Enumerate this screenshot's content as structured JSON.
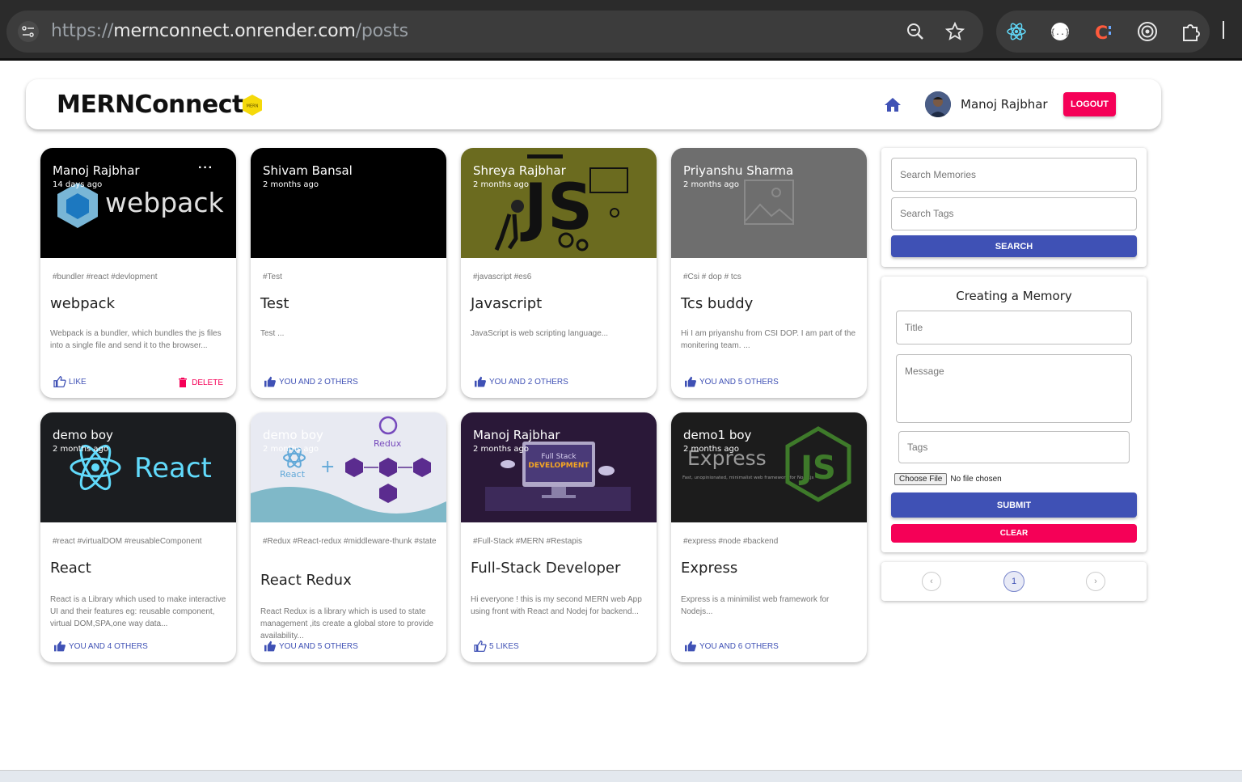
{
  "browser": {
    "url_scheme": "https://",
    "url_host": "mernconnect.onrender.com",
    "url_path": "/posts",
    "icons": [
      "site-settings-icon",
      "zoom-icon",
      "bookmark-star-icon",
      "react-devtools-icon",
      "json-viewer-icon",
      "color-picker-icon",
      "target-icon",
      "extensions-puzzle-icon"
    ]
  },
  "header": {
    "brand": "MERNConnect",
    "logo_text": "MERN",
    "user_name": "Manoj Rajbhar",
    "logout_label": "LOGOUT"
  },
  "posts": [
    {
      "author": "Manoj Rajbhar",
      "time": "14 days ago",
      "tags": "#bundler #react #devlopment",
      "title": "webpack",
      "message": "Webpack is a bundler, which bundles the js files into a single file and send it to the browser...",
      "likes": "LIKE",
      "delete_label": "DELETE",
      "media_bg": "#000000",
      "media_text": "webpack"
    },
    {
      "author": "Shivam Bansal",
      "time": "2 months ago",
      "tags": "#Test",
      "title": "Test",
      "message": "Test ...",
      "likes": "YOU AND 2 OTHERS",
      "media_bg": "#000000"
    },
    {
      "author": "Shreya Rajbhar",
      "time": "2 months ago",
      "tags": "#javascript #es6",
      "title": "Javascript",
      "message": "JavaScript is web scripting language...",
      "likes": "YOU AND 2 OTHERS",
      "media_bg": "#6b6b1f",
      "media_text": "JS"
    },
    {
      "author": "Priyanshu Sharma",
      "time": "2 months ago",
      "tags": "#Csi # dop # tcs",
      "title": "Tcs buddy",
      "message": "Hi I am priyanshu from CSI DOP. I am part of the monitering team. ...",
      "likes": "YOU AND 5 OTHERS",
      "media_bg": "#6e6e6e"
    },
    {
      "author": "demo boy",
      "time": "2 months ago",
      "tags": "#react #virtualDOM #reusableComponent",
      "title": "React",
      "message": "React is a Library which used to make interactive UI and their features eg: reusable component, virtual DOM,SPA,one way data...",
      "likes": "YOU AND 4 OTHERS",
      "media_bg": "#1b1d20",
      "media_text": "React"
    },
    {
      "author": "demo boy",
      "time": "2 months ago",
      "tags": "#Redux #React-redux #middleware-thunk #state",
      "title": "React Redux",
      "message": "React Redux is a library which is used to state management ,its create a global store to provide availability...",
      "likes": "YOU AND 5 OTHERS",
      "media_bg": "#e8eaf2",
      "media_text": "Redux",
      "media_text_2": "React"
    },
    {
      "author": "Manoj Rajbhar",
      "time": "2 months ago",
      "tags": "#Full-Stack #MERN #Restapis",
      "title": "Full-Stack Developer",
      "message": "Hi everyone ! this is my second MERN web App using front with React and Nodej for backend...",
      "likes": "5 LIKES",
      "media_bg": "#2a1838",
      "media_text": "Full Stack",
      "media_text_2": "DEVELOPMENT"
    },
    {
      "author": "demo1 boy",
      "time": "2 months ago",
      "tags": "#express #node #backend",
      "title": "Express",
      "message": "Express is a minimilist web framework for Nodejs...",
      "likes": "YOU AND 6 OTHERS",
      "media_bg": "#1c1c1c",
      "media_text": "Express",
      "media_text_2": "Fast, unopinionated, minimalist web framework for Node.js",
      "media_text_3": "JS"
    }
  ],
  "search": {
    "memories_placeholder": "Search Memories",
    "tags_placeholder": "Search Tags",
    "button": "SEARCH"
  },
  "form": {
    "heading": "Creating a Memory",
    "title_placeholder": "Title",
    "message_placeholder": "Message",
    "tags_placeholder": "Tags",
    "choose_file": "Choose File",
    "no_file": "No file chosen",
    "submit": "SUBMIT",
    "clear": "CLEAR"
  },
  "pagination": {
    "prev": "‹",
    "current": "1",
    "next": "›"
  },
  "colors": {
    "primary": "#3f51b5",
    "secondary": "#f50057"
  }
}
